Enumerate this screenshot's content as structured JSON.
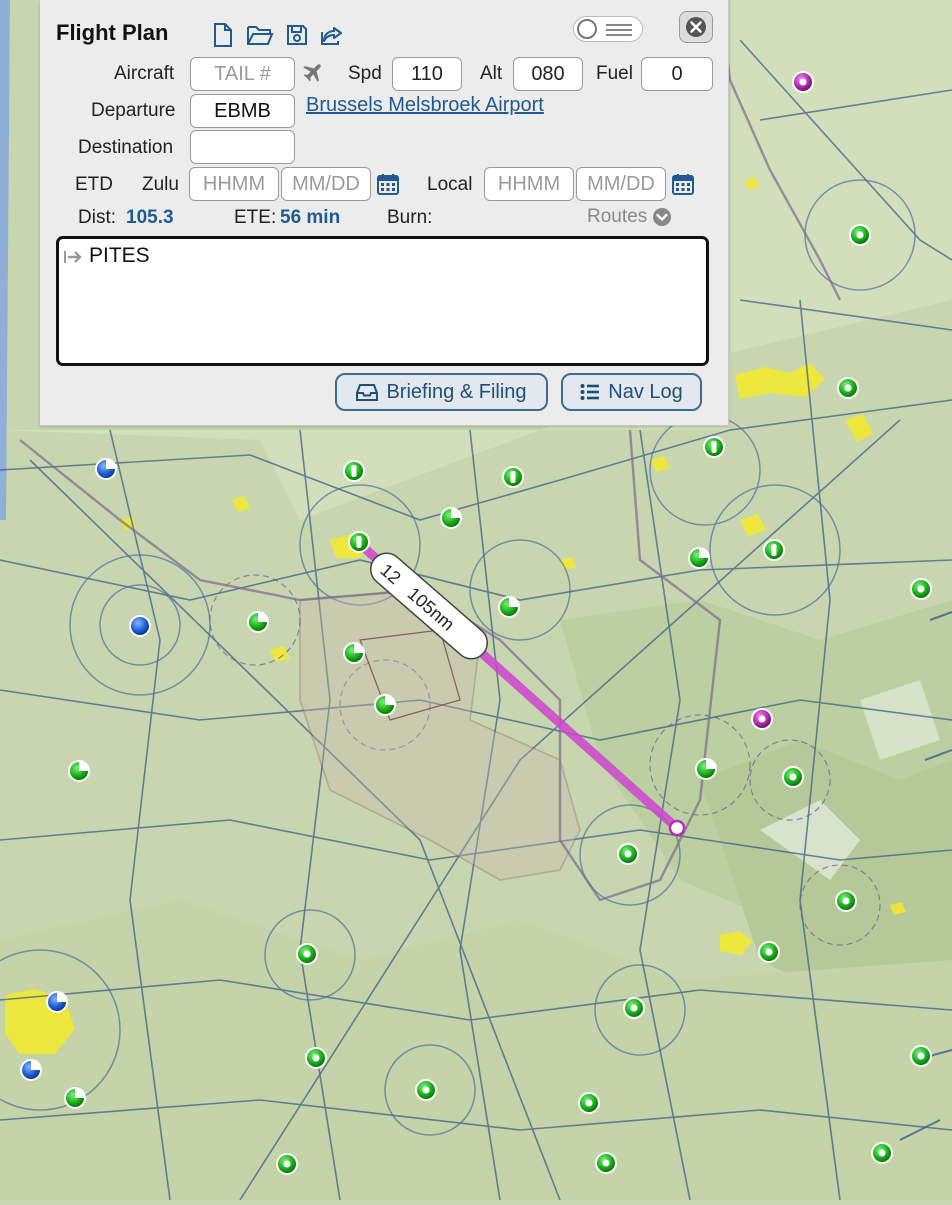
{
  "panel": {
    "title": "Flight Plan",
    "toolbar_icons": [
      "new-file-icon",
      "open-folder-icon",
      "save-icon",
      "share-icon"
    ],
    "toggle_state": "off",
    "close_icon": "close-icon"
  },
  "aircraft": {
    "label": "Aircraft",
    "tail_placeholder": "TAIL #",
    "tail_value": "",
    "icon": "airplane-icon"
  },
  "speed": {
    "label": "Spd",
    "value": "110"
  },
  "altitude": {
    "label": "Alt",
    "value": "080"
  },
  "fuel": {
    "label": "Fuel",
    "value": "0"
  },
  "departure": {
    "label": "Departure",
    "value": "EBMB",
    "airport_name": "Brussels Melsbroek Airport"
  },
  "destination": {
    "label": "Destination",
    "value": ""
  },
  "etd": {
    "label": "ETD",
    "zulu_label": "Zulu",
    "zulu_time_placeholder": "HHMM",
    "zulu_date_placeholder": "MM/DD",
    "local_label": "Local",
    "local_time_placeholder": "HHMM",
    "local_date_placeholder": "MM/DD",
    "calendar_icon": "calendar-icon"
  },
  "stats": {
    "dist_label": "Dist:",
    "dist_value": "105.3",
    "ete_label": "ETE:",
    "ete_value": "56 min",
    "burn_label": "Burn:",
    "burn_value": "",
    "routes_label": "Routes"
  },
  "route": {
    "text": "PITES"
  },
  "buttons": {
    "briefing": "Briefing & Filing",
    "navlog": "Nav Log"
  },
  "map": {
    "leg_label": "105nm",
    "leg_heading_fragment": "12",
    "colors": {
      "route": "#d044d0",
      "airport_towered": "#2d6fd0",
      "airport_untowered": "#22b022",
      "airport_private": "#a82aa8"
    }
  }
}
